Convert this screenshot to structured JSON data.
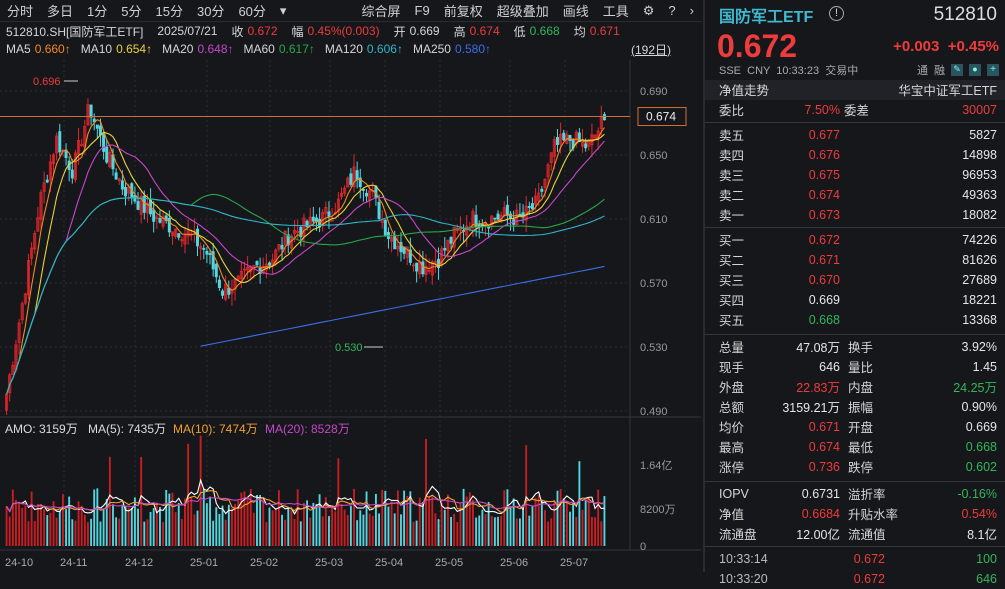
{
  "toolbar": {
    "left": [
      "分时",
      "多日",
      "1分",
      "5分",
      "15分",
      "30分",
      "60分",
      "▾"
    ],
    "right": [
      "综合屏",
      "F9",
      "前复权",
      "超级叠加",
      "画线",
      "工具",
      "⚙",
      "?",
      "›"
    ]
  },
  "info": {
    "code": "512810.SH[国防军工ETF]",
    "date": "2025/07/21",
    "close_label": "收",
    "close": "0.672",
    "chg_label": "幅",
    "chg": "0.45%(0.003)",
    "open_label": "开",
    "open": "0.669",
    "high_label": "高",
    "high": "0.674",
    "low_label": "低",
    "low": "0.668",
    "avg_label": "均",
    "avg": "0.671"
  },
  "ma": [
    {
      "name": "MA5",
      "value": "0.660↑",
      "color": "#f08a24"
    },
    {
      "name": "MA10",
      "value": "0.654↑",
      "color": "#e8d43a"
    },
    {
      "name": "MA20",
      "value": "0.648↑",
      "color": "#c548c8"
    },
    {
      "name": "MA60",
      "value": "0.617↑",
      "color": "#2aa64a"
    },
    {
      "name": "MA120",
      "value": "0.606↑",
      "color": "#2fb4c8"
    },
    {
      "name": "MA250",
      "value": "0.580↑",
      "color": "#3a6ee8"
    }
  ],
  "period": "(192日)",
  "price_axis": [
    "0.690",
    "0.650",
    "0.610",
    "0.570",
    "0.530",
    "0.490"
  ],
  "current_price_tag": "0.674",
  "annotations": {
    "high": "0.696",
    "low": "0.530"
  },
  "amo": {
    "label": "AMO: 3159万",
    "ma5": "MA(5): 7435万",
    "ma10": "MA(10): 7474万",
    "ma20": "MA(20): 8528万"
  },
  "vol_axis": [
    "1.64亿",
    "8200万",
    "0"
  ],
  "x_axis": [
    "24-10",
    "24-11",
    "24-12",
    "25-01",
    "25-02",
    "25-03",
    "25-04",
    "25-05",
    "25-06",
    "25-07"
  ],
  "chart_data": {
    "type": "candlestick",
    "closes_keypoints": [
      0.5,
      0.56,
      0.62,
      0.66,
      0.64,
      0.68,
      0.65,
      0.63,
      0.62,
      0.61,
      0.605,
      0.6,
      0.59,
      0.565,
      0.57,
      0.58,
      0.585,
      0.6,
      0.605,
      0.61,
      0.62,
      0.64,
      0.625,
      0.6,
      0.59,
      0.58,
      0.585,
      0.6,
      0.61,
      0.61,
      0.612,
      0.61,
      0.62,
      0.655,
      0.66,
      0.655,
      0.672
    ],
    "ma250_range": [
      0.53,
      0.58
    ],
    "ylim": [
      0.48,
      0.705
    ],
    "bars": 192
  },
  "quote": {
    "name": "国防军工ETF",
    "code": "512810",
    "price": "0.672",
    "change": "+0.003",
    "pct": "+0.45%",
    "meta": "SSE  CNY  10:33:23  交易中",
    "tags": [
      "通",
      "融"
    ],
    "nav_label": "净值走势",
    "index_name": "华宝中证军工ETF",
    "wb_label": "委比",
    "wb": "7.50%",
    "wc_label": "委差",
    "wc": "30007"
  },
  "asks": [
    {
      "label": "卖五",
      "price": "0.677",
      "vol": "5827"
    },
    {
      "label": "卖四",
      "price": "0.676",
      "vol": "14898"
    },
    {
      "label": "卖三",
      "price": "0.675",
      "vol": "96953"
    },
    {
      "label": "卖二",
      "price": "0.674",
      "vol": "49363"
    },
    {
      "label": "卖一",
      "price": "0.673",
      "vol": "18082"
    }
  ],
  "bids": [
    {
      "label": "买一",
      "price": "0.672",
      "vol": "74226",
      "c": "red"
    },
    {
      "label": "买二",
      "price": "0.671",
      "vol": "81626",
      "c": "red"
    },
    {
      "label": "买三",
      "price": "0.670",
      "vol": "27689",
      "c": "red"
    },
    {
      "label": "买四",
      "price": "0.669",
      "vol": "18221",
      "c": "white"
    },
    {
      "label": "买五",
      "price": "0.668",
      "vol": "13368",
      "c": "green"
    }
  ],
  "stats": [
    [
      "总量",
      "47.08万",
      "white",
      "换手",
      "3.92%",
      "white"
    ],
    [
      "现手",
      "646",
      "white",
      "量比",
      "1.45",
      "white"
    ],
    [
      "外盘",
      "22.83万",
      "red",
      "内盘",
      "24.25万",
      "green"
    ],
    [
      "总额",
      "3159.21万",
      "white",
      "振幅",
      "0.90%",
      "white"
    ],
    [
      "均价",
      "0.671",
      "red",
      "开盘",
      "0.669",
      "white"
    ],
    [
      "最高",
      "0.674",
      "red",
      "最低",
      "0.668",
      "green"
    ],
    [
      "涨停",
      "0.736",
      "red",
      "跌停",
      "0.602",
      "green"
    ]
  ],
  "etf": [
    [
      "IOPV",
      "0.6731",
      "white",
      "溢折率",
      "-0.16%",
      "green"
    ],
    [
      "净值",
      "0.6684",
      "red",
      "升贴水率",
      "0.54%",
      "red"
    ],
    [
      "流通盘",
      "12.00亿",
      "white",
      "流通值",
      "8.1亿",
      "white"
    ]
  ],
  "ticks": [
    {
      "time": "10:33:14",
      "price": "0.672",
      "vol": "100"
    },
    {
      "time": "10:33:20",
      "price": "0.672",
      "vol": "646"
    }
  ]
}
